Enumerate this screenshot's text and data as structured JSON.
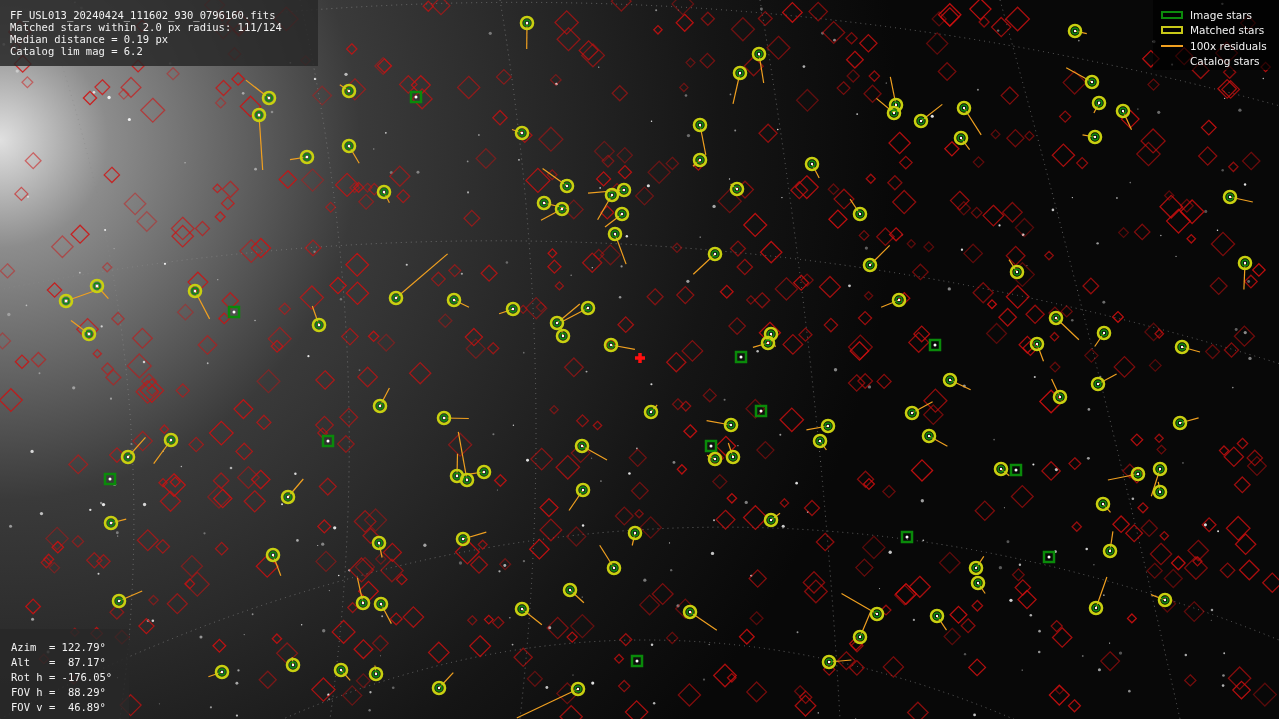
{
  "info_panel": {
    "lines": [
      "FF_USL013_20240424_111602_930_0796160.fits",
      "Matched stars within 2.0 px radius: 111/124",
      "Median distance = 0.19 px",
      "Catalog lim mag = 6.2"
    ]
  },
  "legend": {
    "items": [
      {
        "kind": "image",
        "label": "Image stars"
      },
      {
        "kind": "matched",
        "label": "Matched stars"
      },
      {
        "kind": "residual",
        "label": "100x residuals"
      },
      {
        "kind": "catalog",
        "label": "Catalog stars"
      }
    ]
  },
  "pointing_panel": {
    "lines": [
      "Azim  = 122.79°",
      "Alt   =  87.17°",
      "Rot h = -176.05°",
      "FOV h =  88.29°",
      "FOV v =  46.89°"
    ]
  }
}
